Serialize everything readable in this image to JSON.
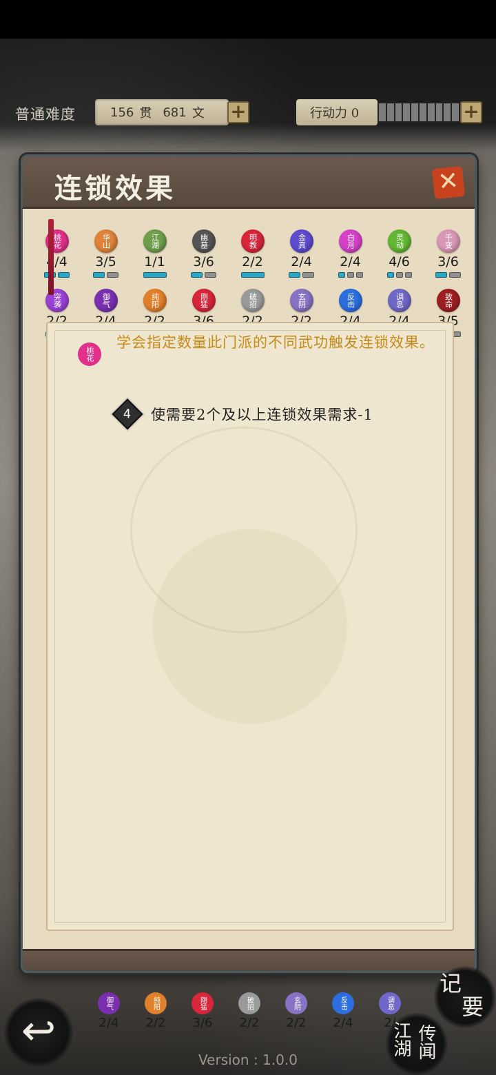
{
  "status": {
    "difficulty": "普通难度",
    "money_guan": "156",
    "guan_unit": "贯",
    "money_wen": "681",
    "wen_unit": "文",
    "energy_label": "行动力 0",
    "plus": "+"
  },
  "panel": {
    "title": "连锁效果",
    "close": "✕"
  },
  "sects": [
    {
      "name": "桃花",
      "count": "4/4",
      "color": "#e0308a",
      "pips": [
        1,
        1
      ]
    },
    {
      "name": "华山",
      "count": "3/5",
      "color": "#e0843c",
      "pips": [
        1,
        0
      ]
    },
    {
      "name": "江湖",
      "count": "1/1",
      "color": "#6f9f4c",
      "pips": [
        1
      ]
    },
    {
      "name": "幽墓",
      "count": "3/6",
      "color": "#555555",
      "pips": [
        1,
        0
      ]
    },
    {
      "name": "明教",
      "count": "2/2",
      "color": "#d8263a",
      "pips": [
        1
      ]
    },
    {
      "name": "金真",
      "count": "2/4",
      "color": "#5d4bd0",
      "pips": [
        1,
        0
      ]
    },
    {
      "name": "白月",
      "count": "2/4",
      "color": "#d641c9",
      "pips": [
        1,
        0,
        0
      ]
    },
    {
      "name": "灵动",
      "count": "4/6",
      "color": "#62b832",
      "pips": [
        1,
        0,
        0
      ]
    },
    {
      "name": "千变",
      "count": "3/6",
      "color": "#d998b6",
      "pips": [
        1,
        0
      ]
    },
    {
      "name": "突袭",
      "count": "2/2",
      "color": "#9a41d6",
      "pips": [
        1
      ]
    },
    {
      "name": "御气",
      "count": "2/4",
      "color": "#7a2fb0",
      "pips": [
        1,
        0
      ]
    },
    {
      "name": "纯阳",
      "count": "2/2",
      "color": "#e0802a",
      "pips": [
        1,
        1
      ]
    },
    {
      "name": "刚猛",
      "count": "3/6",
      "color": "#d8263a",
      "pips": [
        1,
        0,
        0
      ]
    },
    {
      "name": "破招",
      "count": "2/2",
      "color": "#9a9a9a",
      "pips": [
        1
      ]
    },
    {
      "name": "玄阴",
      "count": "2/2",
      "color": "#8872c4",
      "pips": [
        1,
        1
      ]
    },
    {
      "name": "反击",
      "count": "2/4",
      "color": "#2c6ee0",
      "pips": [
        1,
        0
      ]
    },
    {
      "name": "调息",
      "count": "2/4",
      "color": "#7068c8",
      "pips": [
        1,
        0,
        0
      ]
    },
    {
      "name": "致命",
      "count": "3/5",
      "color": "#9e1f22",
      "pips": [
        1,
        0
      ]
    }
  ],
  "description": {
    "icon": "桃花",
    "text": "学会指定数量此门派的不同武功触发连锁效果。"
  },
  "effect": {
    "tier": "4",
    "text": "使需要2个及以上连锁效果需求-1"
  },
  "under_row": [
    {
      "name": "御气",
      "count": "2/4",
      "color": "#7a2fb0"
    },
    {
      "name": "纯阳",
      "count": "2/2",
      "color": "#e0802a"
    },
    {
      "name": "刚猛",
      "count": "3/6",
      "color": "#d8263a"
    },
    {
      "name": "破招",
      "count": "2/2",
      "color": "#9a9a9a"
    },
    {
      "name": "玄阴",
      "count": "2/2",
      "color": "#8872c4"
    },
    {
      "name": "反击",
      "count": "2/4",
      "color": "#2c6ee0"
    },
    {
      "name": "调息",
      "count": "2/",
      "color": "#7068c8"
    }
  ],
  "nav": {
    "back_icon": "↩",
    "notes_a": "记",
    "notes_b": "要",
    "rumors_a": "江湖",
    "rumors_b": "传闻"
  },
  "version": "Version : 1.0.0"
}
